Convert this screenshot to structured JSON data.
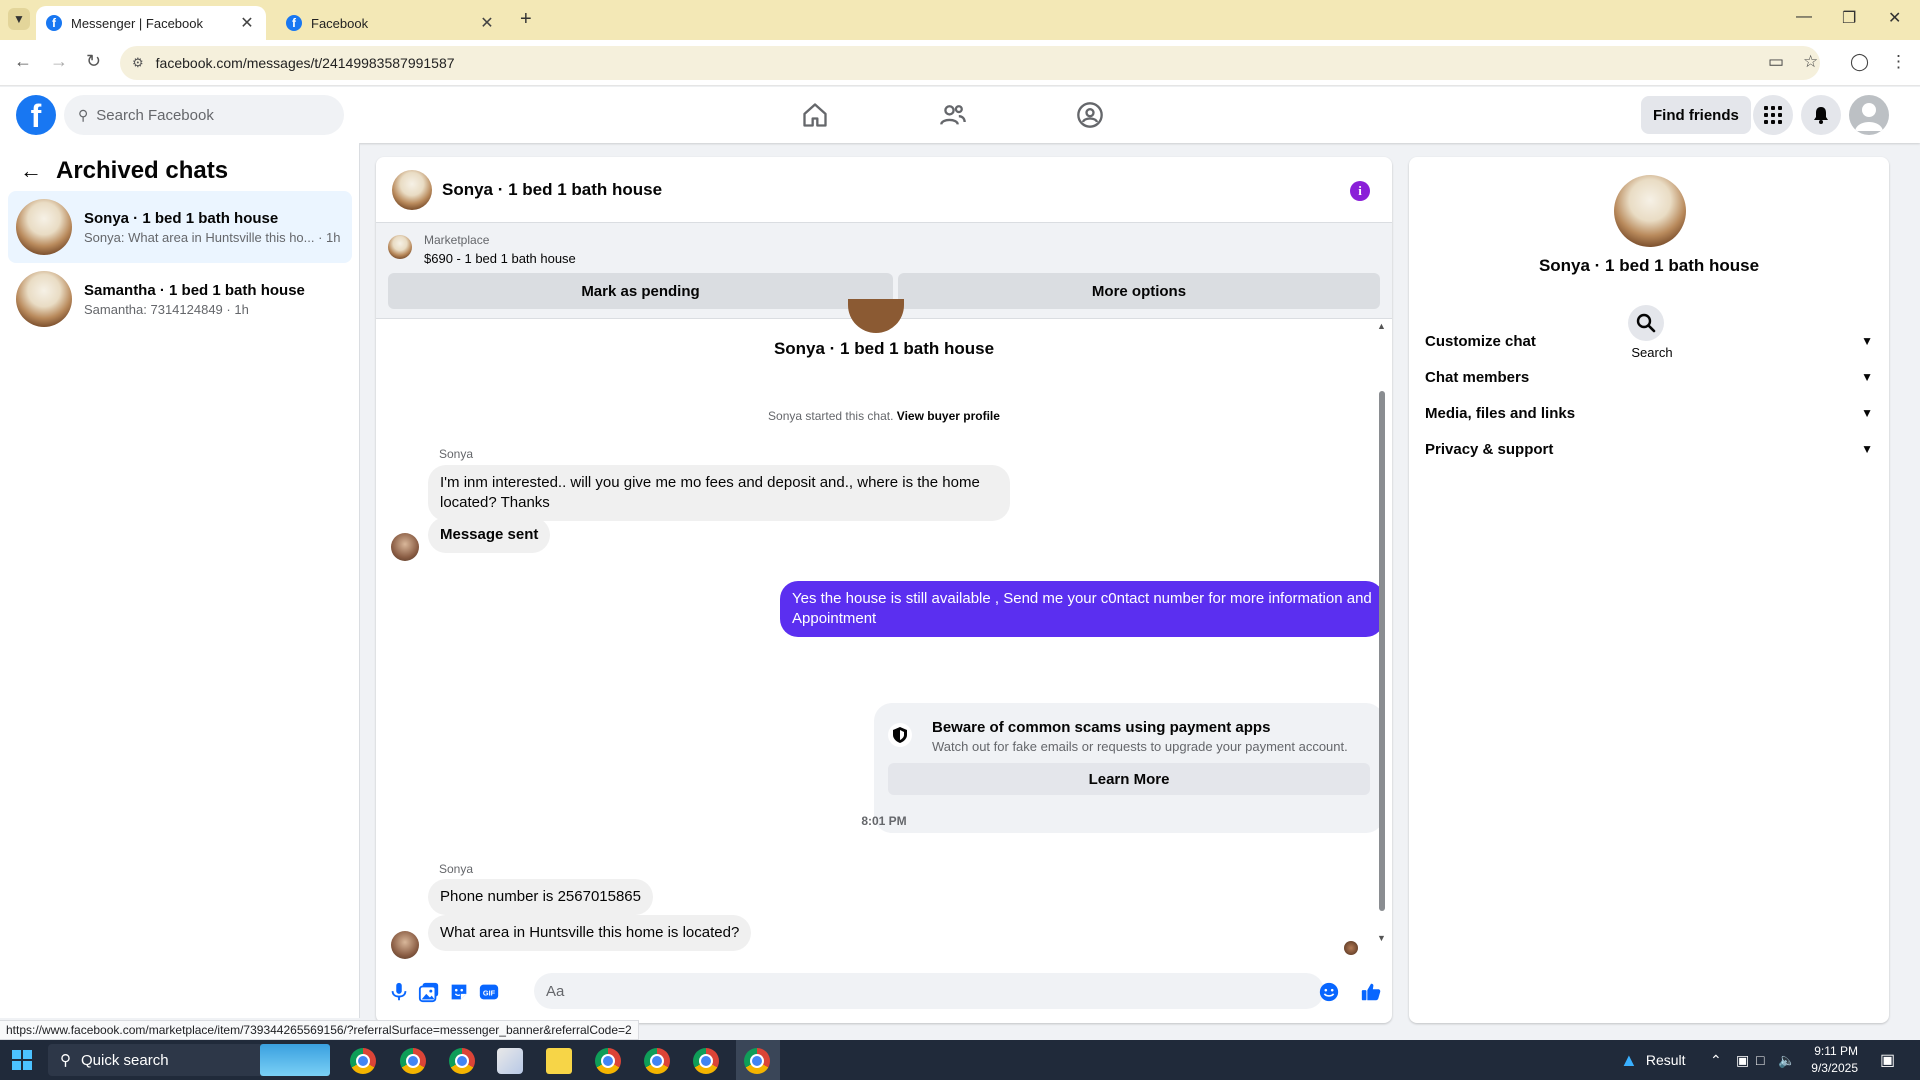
{
  "browser": {
    "tabs": [
      {
        "title": "Messenger | Facebook",
        "active": true
      },
      {
        "title": "Facebook",
        "active": false
      }
    ],
    "url": "facebook.com/messages/t/24149983587991587",
    "status_url": "https://www.facebook.com/marketplace/item/739344265569156/?referralSurface=messenger_banner&referralCode=2"
  },
  "fb_header": {
    "search_placeholder": "Search Facebook",
    "find_friends": "Find friends"
  },
  "left_panel": {
    "title": "Archived chats",
    "chats": [
      {
        "name": "Sonya · 1 bed 1 bath house",
        "preview": "Sonya: What area in Huntsville this ho... · 1h",
        "active": true
      },
      {
        "name": "Samantha · 1 bed 1 bath house",
        "preview": "Samantha: 7314124849 · 1h",
        "active": false
      }
    ]
  },
  "chat": {
    "header_name": "Sonya · 1 bed 1 bath house",
    "marketplace": {
      "label": "Marketplace",
      "item": "$690 - 1 bed 1 bath house",
      "mark_pending": "Mark as pending",
      "more_options": "More options"
    },
    "thread_name": "Sonya · 1 bed 1 bath house",
    "started_text": "Sonya started this chat.",
    "view_buyer": "View buyer profile",
    "sender1": "Sonya",
    "msg1": "I'm inm interested.. will you give me mo fees and deposit and., where is the home located? Thanks",
    "msg2": "Message sent",
    "my_msg": "Yes the house is still available , Send me your c0ntact number for more information and Appointment",
    "scam_title": "Beware of common scams using payment apps",
    "scam_body": "Watch out for fake emails or requests to upgrade your payment account.",
    "learn_more": "Learn More",
    "time": "8:01 PM",
    "sender2": "Sonya",
    "msg3": "Phone number is 2567015865",
    "msg4": "What area in Huntsville this home is located?",
    "composer_placeholder": "Aa"
  },
  "right_panel": {
    "name": "Sonya · 1 bed 1 bath house",
    "search_label": "Search",
    "sections": [
      "Customize chat",
      "Chat members",
      "Media, files and links",
      "Privacy & support"
    ]
  },
  "taskbar": {
    "search": "Quick search",
    "weather": "Result",
    "time": "9:11 PM",
    "date": "9/3/2025"
  },
  "colors": {
    "accent": "#5b2ff0",
    "facebook_blue": "#1877f2",
    "info_purple": "#8a1fd8"
  }
}
